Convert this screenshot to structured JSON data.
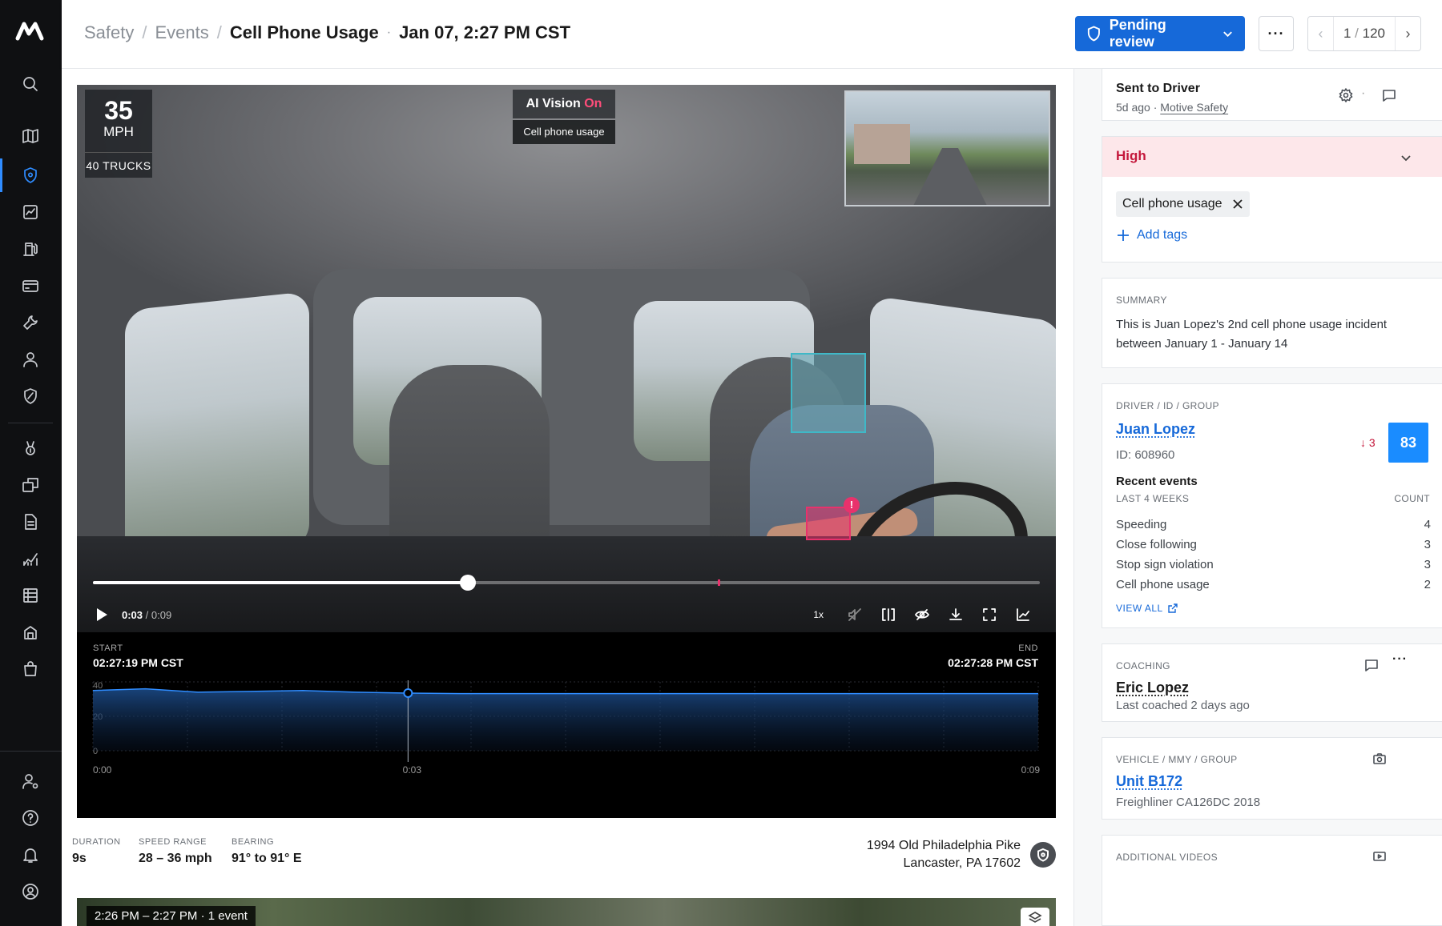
{
  "sidebar": {
    "logo": "motive-logo",
    "items": [
      {
        "icon": "search-icon"
      },
      {
        "icon": "map-icon"
      },
      {
        "icon": "safety-shield-icon",
        "active": true
      },
      {
        "icon": "reports-icon"
      },
      {
        "icon": "fuel-icon"
      },
      {
        "icon": "card-icon"
      },
      {
        "icon": "maintenance-wrench-icon"
      },
      {
        "icon": "driver-icon"
      },
      {
        "icon": "compliance-icon"
      },
      {
        "icon": "coaching-icon"
      },
      {
        "icon": "dispatch-icon"
      },
      {
        "icon": "documents-icon"
      },
      {
        "icon": "analytics-icon"
      },
      {
        "icon": "logs-icon"
      },
      {
        "icon": "assets-icon"
      },
      {
        "icon": "marketplace-icon"
      }
    ],
    "bottom": [
      {
        "icon": "admin-user-icon"
      },
      {
        "icon": "help-icon"
      },
      {
        "icon": "notifications-bell-icon"
      },
      {
        "icon": "account-icon"
      }
    ]
  },
  "header": {
    "breadcrumb": [
      "Safety",
      "Events"
    ],
    "title": "Cell Phone Usage",
    "datetime": "Jan 07, 2:27 PM CST",
    "status_label": "Pending review",
    "more_label": "···",
    "pager": {
      "current": "1",
      "separator": "/",
      "total": "120"
    }
  },
  "video": {
    "speed": "35",
    "speed_unit": "MPH",
    "fleet_label": "40 TRUCKS",
    "ai_vision": "AI Vision",
    "ai_state": "On",
    "ai_detection": "Cell phone usage",
    "current_time": "0:03",
    "duration": "0:09",
    "playback_speed": "1x",
    "progress": 0.396,
    "markers": [
      0.66
    ]
  },
  "timeline": {
    "start_label": "START",
    "start_time": "02:27:19 PM CST",
    "end_label": "END",
    "end_time": "02:27:28 PM CST"
  },
  "chart_data": {
    "type": "area",
    "title": "",
    "xlabel": "",
    "ylabel": "",
    "x_ticks": [
      "0:00",
      "0:03",
      "0:09"
    ],
    "y_ticks": [
      "40",
      "20",
      "0"
    ],
    "ylim": [
      0,
      40
    ],
    "xlim": [
      0,
      9
    ],
    "x": [
      0,
      0.5,
      1,
      1.5,
      2,
      2.5,
      3,
      3.5,
      4,
      4.5,
      5,
      5.5,
      6,
      6.5,
      7,
      7.5,
      8,
      8.5,
      9
    ],
    "values": [
      35,
      36,
      34,
      34.5,
      35,
      34,
      33.5,
      33.2,
      33.2,
      33.2,
      33.2,
      33.2,
      33.2,
      33.2,
      33.2,
      33.2,
      33.2,
      33.2,
      33.2
    ],
    "cursor_x": 3,
    "grid": true
  },
  "stats": [
    {
      "label": "DURATION",
      "value": "9s"
    },
    {
      "label": "SPEED RANGE",
      "value": "28 – 36 mph"
    },
    {
      "label": "BEARING",
      "value": "91° to 91° E"
    }
  ],
  "address": {
    "line1": "1994 Old Philadelphia Pike",
    "line2": "Lancaster, PA 17602"
  },
  "map": {
    "label": "2:26 PM – 2:27 PM · 1 event"
  },
  "panel": {
    "sent": {
      "title": "Sent to Driver",
      "ago": "5d ago",
      "sep": "·",
      "by": "Motive Safety",
      "dot": "·"
    },
    "severity": {
      "label": "High",
      "bg": "#fde7ea",
      "color": "#c4173b"
    },
    "tags": {
      "items": [
        "Cell phone usage"
      ],
      "add_label": "Add tags"
    },
    "summary": {
      "label": "SUMMARY",
      "text": "This is Juan Lopez's 2nd cell phone usage incident between January 1 - January 14"
    },
    "driver": {
      "label": "DRIVER / ID / GROUP",
      "name": "Juan Lopez",
      "id": "ID: 608960",
      "score_delta": "↓ 3",
      "score": "83",
      "recent_title": "Recent events",
      "recent_period": "LAST 4 WEEKS",
      "count_label": "COUNT",
      "events": [
        {
          "name": "Speeding",
          "count": "4"
        },
        {
          "name": "Close following",
          "count": "3"
        },
        {
          "name": "Stop sign violation",
          "count": "3"
        },
        {
          "name": "Cell phone usage",
          "count": "2"
        }
      ],
      "view_all": "VIEW ALL"
    },
    "coaching": {
      "label": "COACHING",
      "name": "Eric Lopez",
      "last": "Last coached 2 days ago"
    },
    "vehicle": {
      "label": "VEHICLE / MMY / GROUP",
      "name": "Unit B172",
      "model": "Freighliner CA126DC 2018"
    },
    "additional": {
      "label": "ADDITIONAL VIDEOS"
    }
  },
  "colors": {
    "primary": "#1669d9",
    "alert": "#e8326c",
    "sidebar": "#0f1012",
    "score_bg": "#1a8cff"
  }
}
